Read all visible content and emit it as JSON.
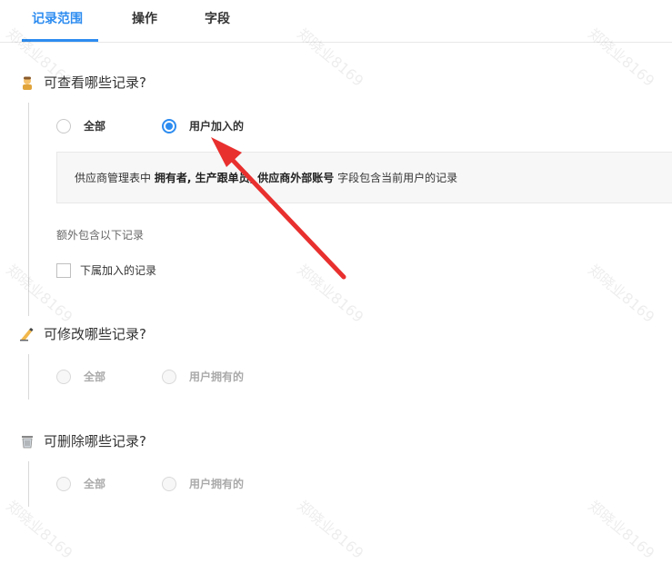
{
  "tabs": [
    {
      "label": "记录范围",
      "active": true
    },
    {
      "label": "操作",
      "active": false
    },
    {
      "label": "字段",
      "active": false
    }
  ],
  "view": {
    "title": "可查看哪些记录?",
    "icon": "person-icon",
    "options": [
      "全部",
      "用户加入的"
    ],
    "selected": "用户加入的",
    "info": {
      "prefix": "供应商管理表中 ",
      "fields": "拥有者, 生产跟单员, 供应商外部账号",
      "suffix": " 字段包含当前用户的记录"
    },
    "extra_label": "额外包含以下记录",
    "checkbox_label": "下属加入的记录",
    "checkbox_checked": false
  },
  "edit": {
    "title": "可修改哪些记录?",
    "icon": "writing-hand-icon",
    "options": [
      "全部",
      "用户拥有的"
    ]
  },
  "delete": {
    "title": "可删除哪些记录?",
    "icon": "trash-icon",
    "options": [
      "全部",
      "用户拥有的"
    ]
  },
  "watermark": "郑晓业8169",
  "colors": {
    "accent": "#2d8cf0",
    "arrow": "#e8302f"
  }
}
